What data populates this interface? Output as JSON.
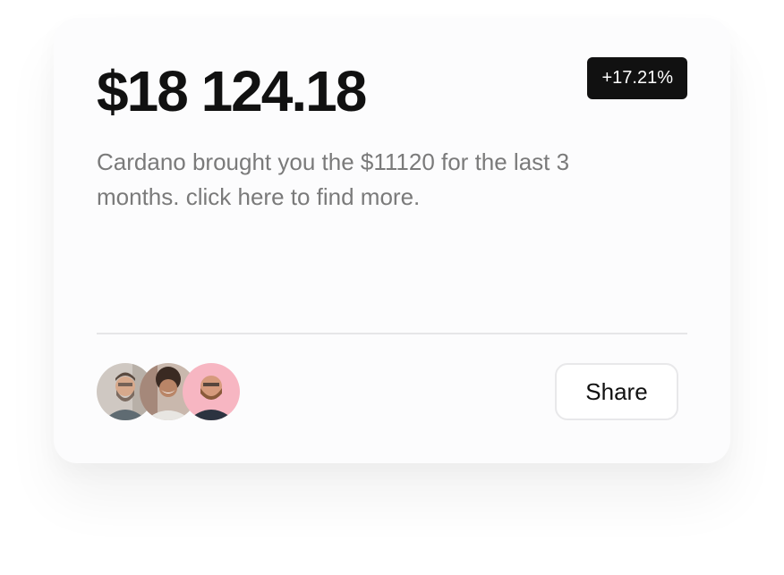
{
  "card": {
    "amount": "$18 124.18",
    "change_badge": "+17.21%",
    "description": "Cardano brought you the $11120 for the last 3 months. click here to find more.",
    "share_label": "Share"
  },
  "avatars": [
    {
      "name": "avatar-1"
    },
    {
      "name": "avatar-2"
    },
    {
      "name": "avatar-3"
    }
  ],
  "colors": {
    "text_primary": "#111111",
    "text_secondary": "#7a7a7a",
    "badge_bg": "#111111",
    "badge_text": "#ffffff",
    "divider": "#e6e6e8",
    "avatar3_bg": "#f7b6c2"
  }
}
